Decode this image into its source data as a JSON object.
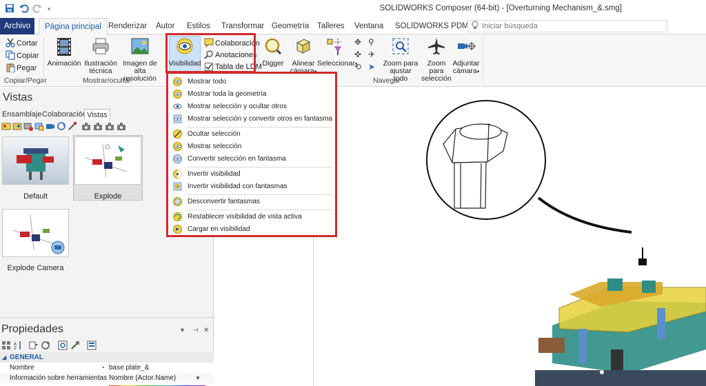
{
  "window": {
    "title": "SOLIDWORKS Composer (64-bit) - [Overturning Mechanism_&.smg]"
  },
  "tabs": {
    "file": "Archivo",
    "home": "Página principal",
    "render": "Renderizar",
    "author": "Autor",
    "styles": "Estilos",
    "transform": "Transformar",
    "geometry": "Geometría",
    "workshops": "Talleres",
    "window": "Ventana",
    "pdm": "SOLIDWORKS PDM",
    "search_placeholder": "Iniciar búsqueda"
  },
  "ribbon": {
    "clipboard": {
      "cut": "Cortar",
      "copy": "Copiar",
      "paste": "Pegar",
      "group": "Copiar/Pegar"
    },
    "show_hide": {
      "animation": "Animación",
      "tech_illus_1": "Ilustración",
      "tech_illus_2": "técnica",
      "hires_1": "Imagen de",
      "hires_2": "alta resolución",
      "visibility": "Visibilidad",
      "collaboration": "Colaboración",
      "annotations": "Anotaciones",
      "bom_table": "Tabla de LDM",
      "group": "Mostrar/ocultar"
    },
    "navigate": {
      "digger": "Digger",
      "align_cam_1": "Alinear",
      "align_cam_2": "cámara",
      "select": "Seleccionar",
      "zoom_fit_1": "Zoom para",
      "zoom_fit_2": "ajustar todo",
      "zoom_sel_1": "Zoom para",
      "zoom_sel_2": "selección",
      "attach_cam_1": "Adjuntar",
      "attach_cam_2": "cámara",
      "group": "Navegar"
    }
  },
  "left_panel": {
    "title": "Vistas",
    "subtabs": [
      "Ensamblaje",
      "Colaboración",
      "Vistas"
    ],
    "views": [
      {
        "label": "Default"
      },
      {
        "label": "Explode"
      },
      {
        "label": "Explode Camera"
      }
    ]
  },
  "properties": {
    "title": "Propiedades",
    "pin": "▾",
    "dock": "⊣",
    "close": "✕",
    "section": "GENERAL",
    "rows": [
      {
        "key": "Nombre",
        "value": "base plate_&"
      },
      {
        "key": "Información sobre herramientas",
        "value": "Nombre (Actor.Name)"
      }
    ]
  },
  "visibility_menu": {
    "items": [
      "Mostrar todo",
      "Mostrar toda la geometría",
      "Mostrar selección y ocultar otros",
      "Mostrar selección y convertir otros en fantasma",
      "Ocultar selección",
      "Mostrar selección",
      "Convertir selección en fantasma",
      "Invertir visibilidad",
      "Invertir visibilidad con fantasmas",
      "Desconvertir fantasmas",
      "Restablecer visibilidad de vista activa",
      "Cargar en visibilidad"
    ]
  },
  "colors": {
    "accent": "#1f5ea8",
    "file_tab": "#213a7a",
    "highlight_red": "#d22a2a",
    "model_yellow": "#e8d23a",
    "model_teal": "#2e8e85"
  }
}
